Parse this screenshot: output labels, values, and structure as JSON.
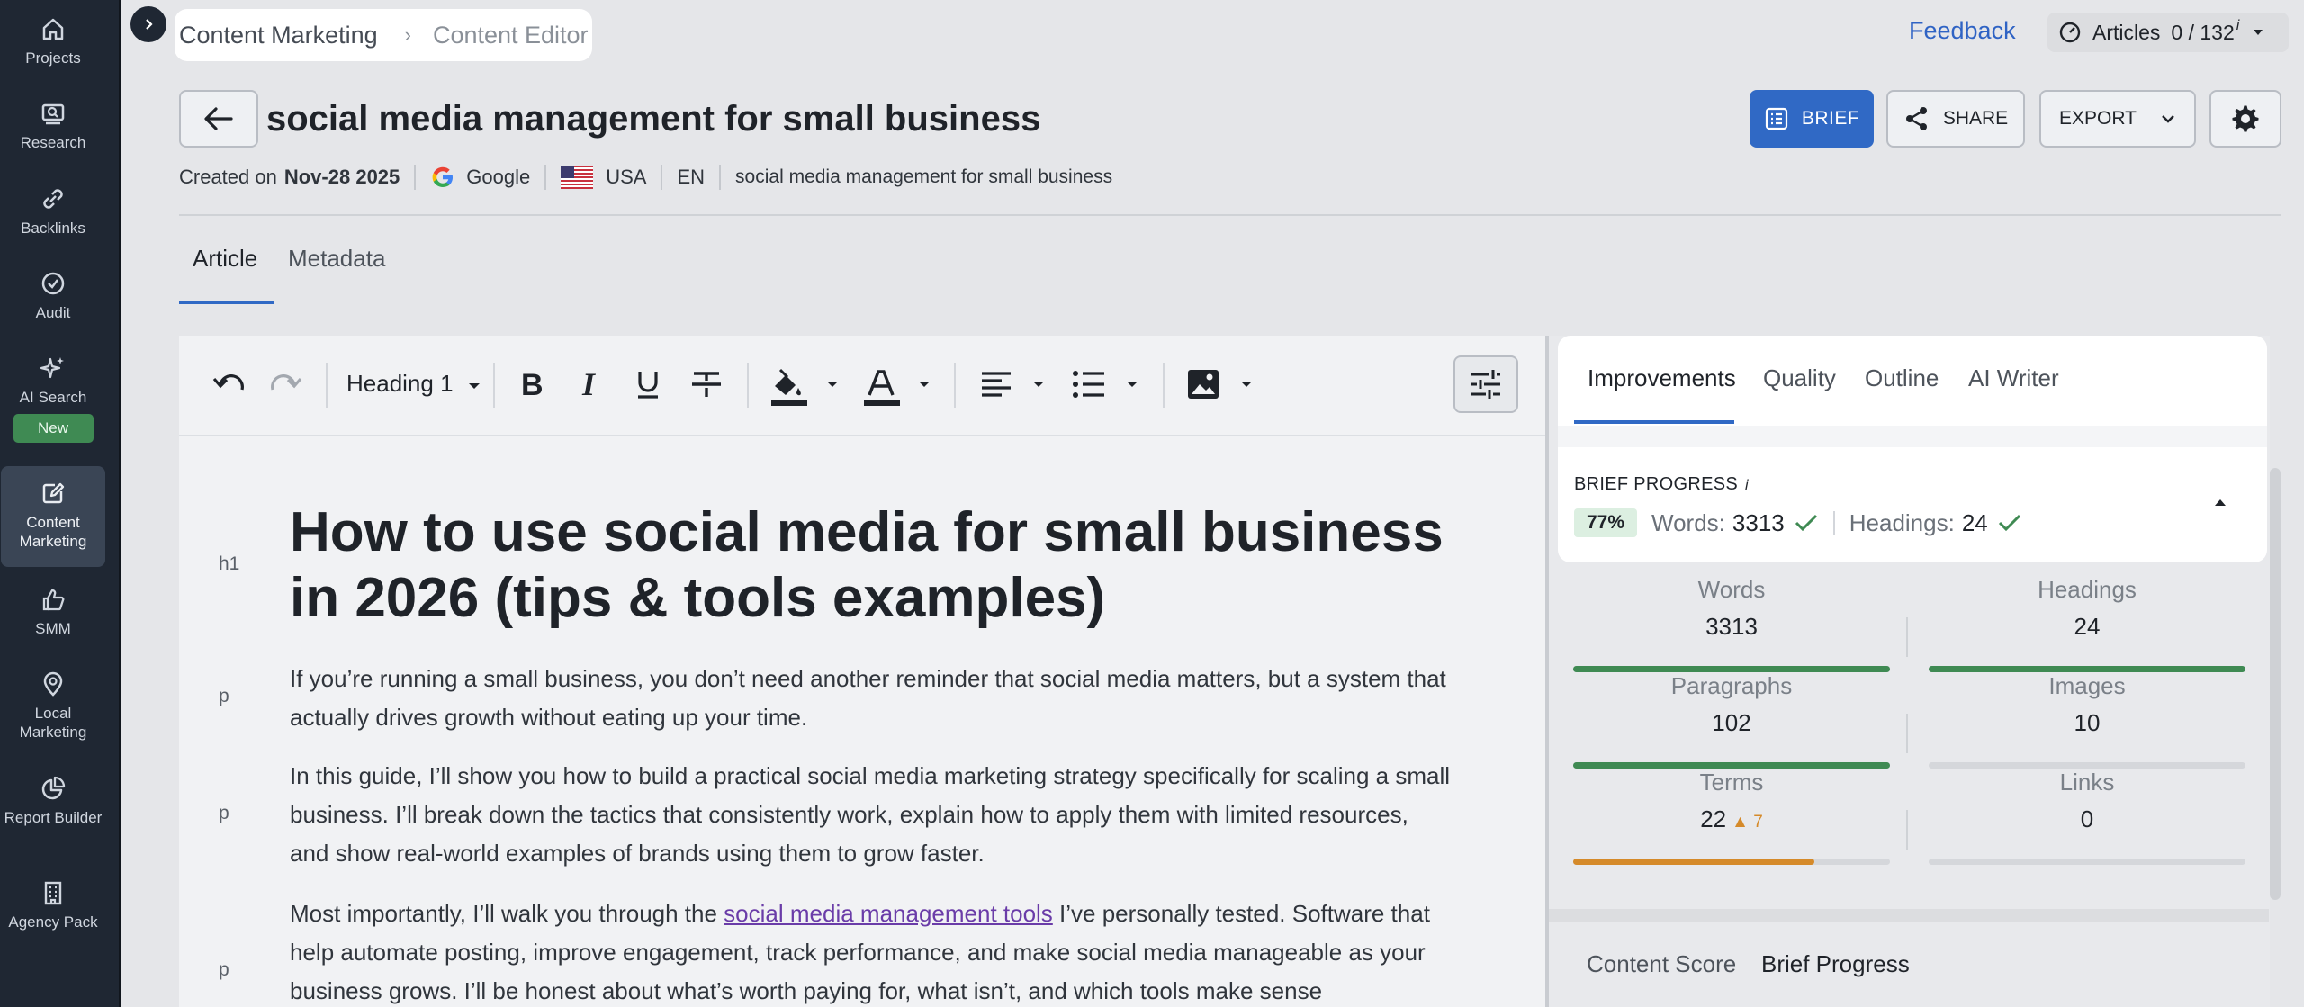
{
  "nav": {
    "items": [
      {
        "label": "Projects",
        "icon": "home-icon"
      },
      {
        "label": "Research",
        "icon": "research-icon"
      },
      {
        "label": "Backlinks",
        "icon": "link-icon"
      },
      {
        "label": "Audit",
        "icon": "check-circle-icon"
      },
      {
        "label": "AI Search",
        "icon": "sparkle-icon",
        "badge": "New"
      },
      {
        "label": "Content Marketing",
        "icon": "edit-icon",
        "active": true
      },
      {
        "label": "SMM",
        "icon": "thumbs-up-icon"
      },
      {
        "label": "Local Marketing",
        "icon": "map-pin-icon"
      },
      {
        "label": "Report Builder",
        "icon": "pie-chart-icon"
      },
      {
        "label": "Agency Pack",
        "icon": "building-icon"
      }
    ]
  },
  "breadcrumb": {
    "item1": "Content Marketing",
    "item2": "Content Editor"
  },
  "header": {
    "feedback": "Feedback",
    "articles_label": "Articles",
    "articles_count": "0 / 132",
    "articles_info": "i"
  },
  "doc": {
    "title": "social media management for small business",
    "created_label": "Created on",
    "created_date": "Nov-28 2025",
    "engine": "Google",
    "country": "USA",
    "language": "EN",
    "keyword": "social media management for small business"
  },
  "actions": {
    "brief": "BRIEF",
    "share": "SHARE",
    "export": "EXPORT"
  },
  "tabs": {
    "article": "Article",
    "metadata": "Metadata"
  },
  "toolbar": {
    "heading": "Heading 1"
  },
  "content": {
    "tag_h1": "h1",
    "tag_p": "p",
    "h1": "How to use social media for small business in 2026 (tips & tools examples)",
    "p1": "If you’re running a small business, you don’t need another reminder that social media matters, but a system that actually drives growth without eating up your time.",
    "p2": "In this guide, I’ll show you how to build a practical social media marketing strategy specifically for scaling a small business. I’ll break down the tactics that consistently work, explain how to apply them with limited resources, and show real-world examples of brands using them to grow faster.",
    "p3_before": "Most importantly, I’ll walk you through the ",
    "p3_link": "social media management tools",
    "p3_after": " I’ve personally tested. Software that help automate posting, improve engagement, track performance, and make social media manageable as your business grows. I’ll be honest about what’s worth paying for, what isn’t, and which tools make sense"
  },
  "panel": {
    "tabs": [
      "Improvements",
      "Quality",
      "Outline",
      "AI Writer"
    ],
    "brief_title": "BRIEF PROGRESS",
    "brief_info": "i",
    "brief_pct": "77%",
    "words_label": "Words:",
    "words_val": "3313",
    "headings_label": "Headings:",
    "headings_val": "24",
    "stats": [
      {
        "label": "Words",
        "value": "3313",
        "progress": 1.0,
        "color": "#3f8a53"
      },
      {
        "label": "Headings",
        "value": "24",
        "progress": 1.0,
        "color": "#3f8a53"
      },
      {
        "label": "Paragraphs",
        "value": "102",
        "progress": 1.0,
        "color": "#3f8a53"
      },
      {
        "label": "Images",
        "value": "10",
        "progress": 0.0,
        "color": "#3f8a53"
      },
      {
        "label": "Terms",
        "value": "22",
        "delta": "▲ 7",
        "progress": 0.76,
        "color": "#d58a2a"
      },
      {
        "label": "Links",
        "value": "0",
        "progress": 0.0,
        "color": "#3f8a53"
      }
    ],
    "bottom_tabs": [
      "Content Score",
      "Brief Progress"
    ]
  }
}
